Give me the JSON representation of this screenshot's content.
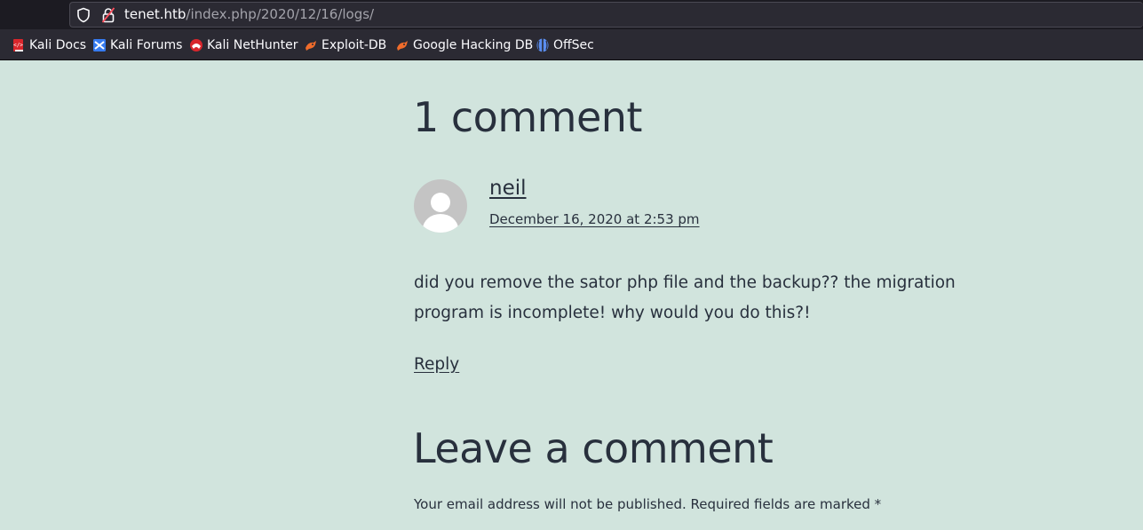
{
  "browser": {
    "url_host": "tenet.htb",
    "url_path": "/index.php/2020/12/16/logs/",
    "icons": {
      "tracking_protection": "shield-icon",
      "security": "insecure-lock-icon"
    },
    "bookmarks": [
      {
        "label": "Kali Docs",
        "icon": "kali-docs-icon"
      },
      {
        "label": "Kali Forums",
        "icon": "kali-forums-icon"
      },
      {
        "label": "Kali NetHunter",
        "icon": "kali-nethunter-icon"
      },
      {
        "label": "Exploit-DB",
        "icon": "exploit-db-icon"
      },
      {
        "label": "Google Hacking DB",
        "icon": "google-hacking-db-icon"
      },
      {
        "label": "OffSec",
        "icon": "offsec-icon"
      }
    ]
  },
  "comments": {
    "heading": "1 comment",
    "items": [
      {
        "author": "neil",
        "date": "December 16, 2020 at 2:53 pm",
        "text": "did you remove the sator php file and the backup?? the migration program is incomplete! why would you do this?!",
        "reply_label": "Reply"
      }
    ]
  },
  "respond": {
    "heading": "Leave a comment",
    "notice": "Your email address will not be published. Required fields are marked *"
  },
  "colors": {
    "page_background": "#d1e4dd",
    "text": "#28303d",
    "toolbar": "#2b2a33"
  }
}
